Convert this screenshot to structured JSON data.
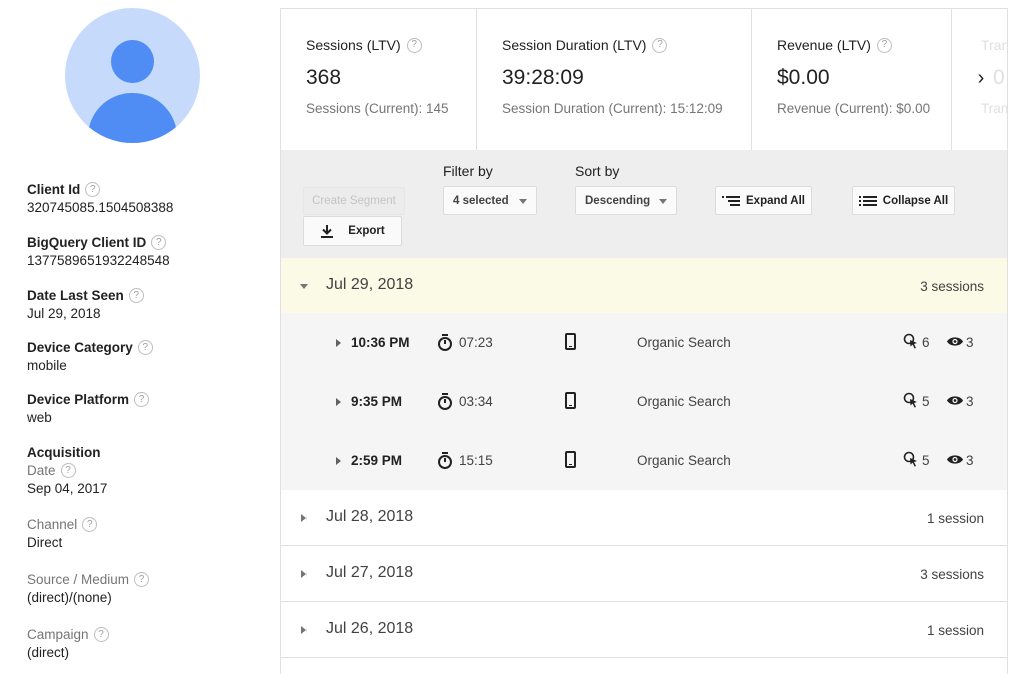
{
  "profile": {
    "fields": [
      {
        "label": "Client Id",
        "value": "320745085.1504508388"
      },
      {
        "label": "BigQuery Client ID",
        "value": "1377589651932248548"
      },
      {
        "label": "Date Last Seen",
        "value": "Jul 29, 2018"
      },
      {
        "label": "Device Category",
        "value": "mobile"
      },
      {
        "label": "Device Platform",
        "value": "web"
      }
    ],
    "acquisition": {
      "heading": "Acquisition",
      "fields": [
        {
          "label": "Date",
          "value": "Sep 04, 2017"
        },
        {
          "label": "Channel",
          "value": "Direct"
        },
        {
          "label": "Source / Medium",
          "value": "(direct)/(none)"
        },
        {
          "label": "Campaign",
          "value": "(direct)"
        }
      ]
    },
    "help_glyph": "?"
  },
  "stats": [
    {
      "title": "Sessions (LTV)",
      "value": "368",
      "sub": "Sessions (Current): 145"
    },
    {
      "title": "Session Duration (LTV)",
      "value": "39:28:09",
      "sub": "Session Duration (Current): 15:12:09"
    },
    {
      "title": "Revenue (LTV)",
      "value": "$0.00",
      "sub": "Revenue (Current): $0.00"
    },
    {
      "title": "Tran",
      "value": "0",
      "sub": "Tran"
    }
  ],
  "stats_next_glyph": "›",
  "toolbar": {
    "create_segment": "Create Segment",
    "export": "Export",
    "filter_label": "Filter by",
    "filter_value": "4 selected",
    "sort_label": "Sort by",
    "sort_value": "Descending",
    "expand_all": "Expand All",
    "collapse_all": "Collapse All"
  },
  "days": [
    {
      "date": "Jul 29, 2018",
      "count": "3 sessions",
      "expanded": true
    },
    {
      "date": "Jul 28, 2018",
      "count": "1 session",
      "expanded": false
    },
    {
      "date": "Jul 27, 2018",
      "count": "3 sessions",
      "expanded": false
    },
    {
      "date": "Jul 26, 2018",
      "count": "1 session",
      "expanded": false
    }
  ],
  "sessions": [
    {
      "time": "10:36 PM",
      "duration": "07:23",
      "channel": "Organic Search",
      "hits": "6",
      "pageviews": "3"
    },
    {
      "time": "9:35 PM",
      "duration": "03:34",
      "channel": "Organic Search",
      "hits": "5",
      "pageviews": "3"
    },
    {
      "time": "2:59 PM",
      "duration": "15:15",
      "channel": "Organic Search",
      "hits": "5",
      "pageviews": "3"
    }
  ],
  "colors": {
    "avatar_bg": "#c6dafc",
    "avatar_fg": "#4f8df5",
    "expanded_day_bg": "#fafae6",
    "toolbar_bg": "#eeeeee"
  }
}
